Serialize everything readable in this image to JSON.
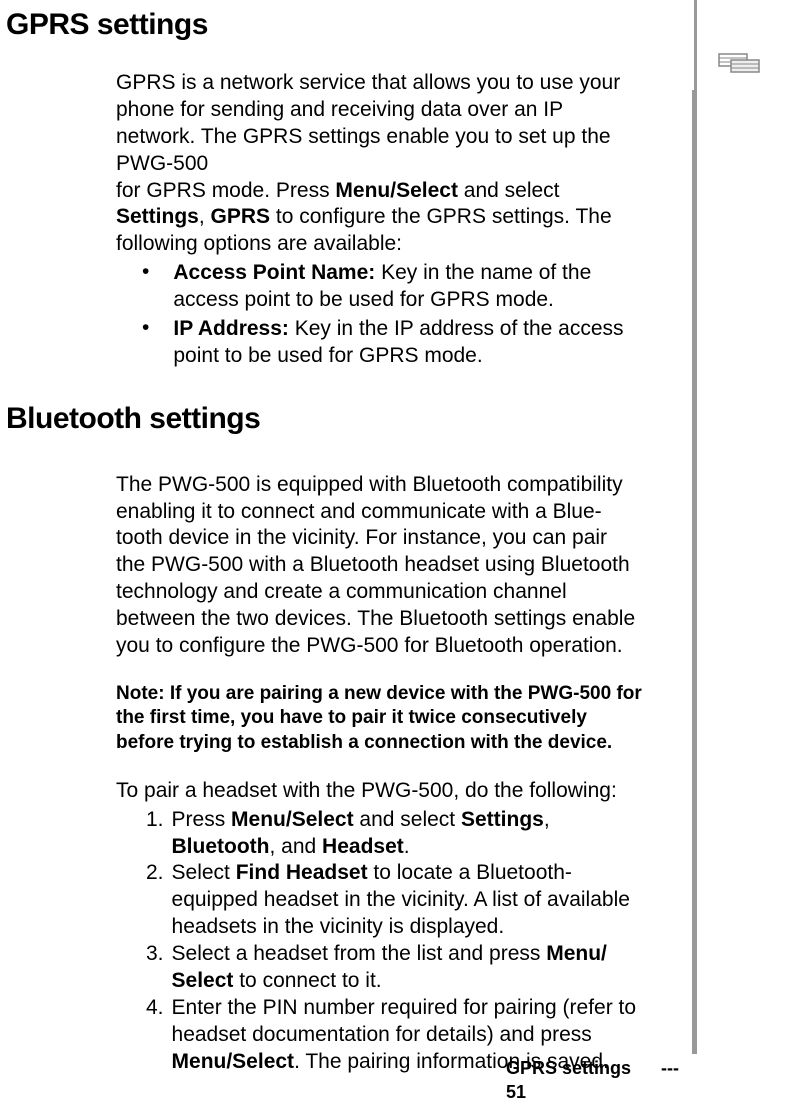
{
  "heading1": "GPRS settings",
  "gprs_intro_1": "GPRS is a network service that allows you to use your phone for sending and receiving data over an IP network. The GPRS settings enable you to set up the PWG-500",
  "gprs_intro_2a": "for GPRS mode. Press ",
  "gprs_menu_select": "Menu/Select",
  "gprs_intro_2b": " and select ",
  "gprs_settings_label": "Settings",
  "gprs_intro_2c": ", ",
  "gprs_label": "GPRS",
  "gprs_intro_2d": " to configure the GPRS settings. The following options are available:",
  "bullets": [
    {
      "title": "Access Point Name:",
      "text": " Key in the name of the access point to be used for GPRS mode."
    },
    {
      "title": "IP Address:",
      "text": " Key in the IP address of the access point to be used for GPRS mode."
    }
  ],
  "heading2": "Bluetooth settings",
  "bt_intro_1": "The PWG-500 is equipped with Bluetooth compatibility enabling it to connect and communicate with a Blue- tooth device in the vicinity. For instance, you can pair",
  "bt_intro_2": "the PWG-500 with a Bluetooth headset using Bluetooth technology and create a communication channel",
  "bt_intro_3": "between the two devices. The Bluetooth settings enable you to configure the PWG-500 for Bluetooth operation.",
  "bt_note": "Note: If you are pairing a new device with the PWG-500 for the first time, you have to pair it twice consecutively before trying to establish a connection with the device.",
  "bt_pair_intro": "To pair a headset with the PWG-500, do the following:",
  "steps": {
    "s1a": "Press ",
    "s1_menu": "Menu/Select",
    "s1b": " and select ",
    "s1_settings": "Settings",
    "s1c": ", ",
    "s1_bluetooth": "Bluetooth",
    "s1d": ", and ",
    "s1_headset": "Headset",
    "s1e": ".",
    "s2a": "Select ",
    "s2_find": "Find Headset",
    "s2b": " to locate a Bluetooth-equipped headset in the vicinity. A list of available headsets in the vicinity is displayed.",
    "s3a": "Select a headset from the list and press ",
    "s3_menu": "Menu/ Select",
    "s3b": " to connect to it.",
    "s4a": "Enter the PIN number required for pairing (refer to headset documentation for details) and press ",
    "s4_menu": "Menu/Select",
    "s4b": ". The pairing information is saved."
  },
  "footer_title": "GPRS settings",
  "footer_dash": "---",
  "footer_page": "51"
}
